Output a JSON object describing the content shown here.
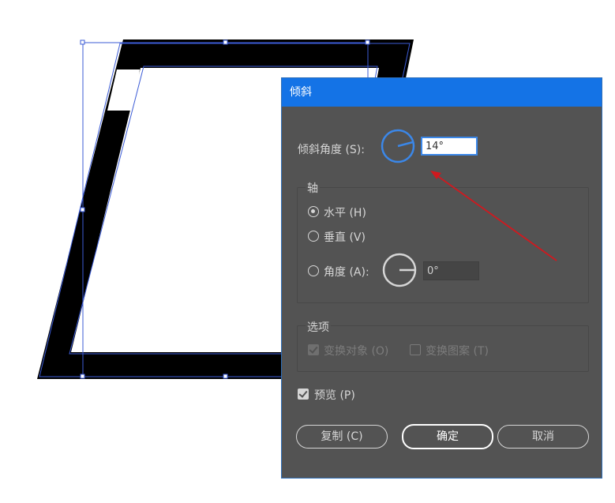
{
  "dialog": {
    "title": "倾斜",
    "shear_angle_label": "倾斜角度 (S):",
    "shear_angle_value": "14°",
    "axis": {
      "title": "轴",
      "horizontal_label": "水平 (H)",
      "vertical_label": "垂直 (V)",
      "angle_label": "角度 (A):",
      "angle_value": "0°",
      "selected": "horizontal"
    },
    "options": {
      "title": "选项",
      "transform_objects_label": "变换对象 (O)",
      "transform_objects_checked": true,
      "transform_patterns_label": "变换图案 (T)",
      "transform_patterns_checked": false,
      "disabled": true
    },
    "preview_label": "预览 (P)",
    "preview_checked": true,
    "buttons": {
      "copy": "复制 (C)",
      "ok": "确定",
      "cancel": "取消"
    }
  },
  "colors": {
    "titlebar": "#1473e6",
    "dialog_bg": "#535353",
    "annotation_arrow": "#d0191f",
    "selection": "#3b5bd6"
  },
  "icons": {
    "shear_dial": "angle-dial-icon",
    "axis_dial": "angle-dial-icon"
  }
}
